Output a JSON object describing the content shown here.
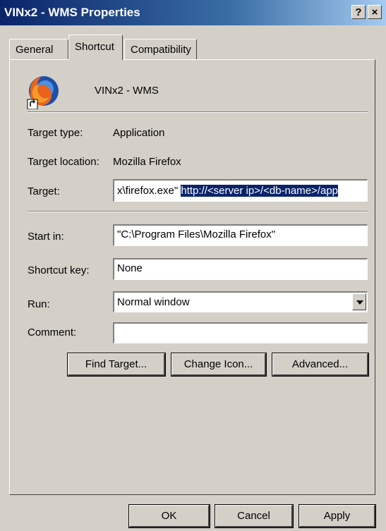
{
  "window": {
    "title": "VINx2 -  WMS Properties",
    "help_glyph": "?",
    "close_glyph": "×"
  },
  "tabs": [
    {
      "label": "General"
    },
    {
      "label": "Shortcut"
    },
    {
      "label": "Compatibility"
    }
  ],
  "shortcut": {
    "name": "VINx2 -  WMS",
    "target_type_label": "Target type:",
    "target_type_value": "Application",
    "target_location_label": "Target location:",
    "target_location_value": "Mozilla Firefox",
    "target_label": "Target:",
    "target_value_prefix": "x\\firefox.exe\"  ",
    "target_value_selected": "http://<server ip>/<db-name>/app",
    "start_in_label": "Start in:",
    "start_in_value": "\"C:\\Program Files\\Mozilla Firefox\"",
    "shortcut_key_label": "Shortcut key:",
    "shortcut_key_value": "None",
    "run_label": "Run:",
    "run_value": "Normal window",
    "comment_label": "Comment:",
    "comment_value": ""
  },
  "buttons": {
    "find_target": "Find Target...",
    "change_icon": "Change Icon...",
    "advanced": "Advanced...",
    "ok": "OK",
    "cancel": "Cancel",
    "apply": "Apply"
  }
}
